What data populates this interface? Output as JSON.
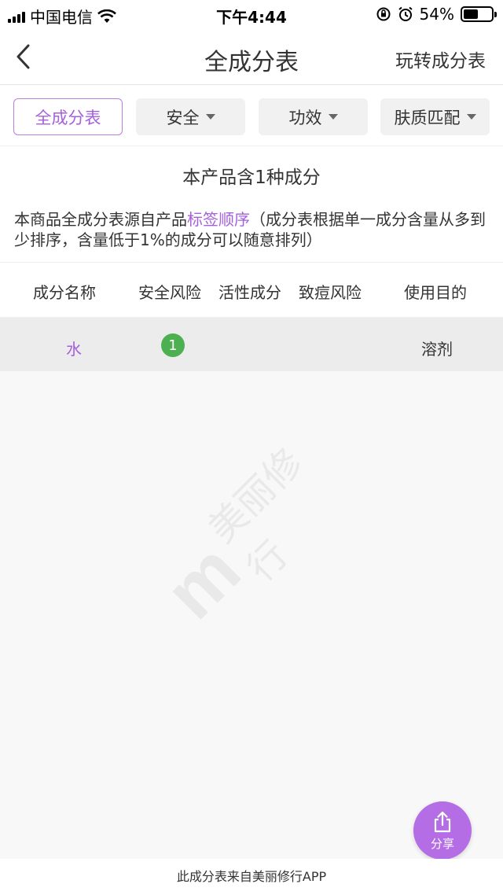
{
  "status_bar": {
    "carrier": "中国电信",
    "time": "下午4:44",
    "battery_percent": "54%",
    "battery_level": 0.54
  },
  "nav": {
    "title": "全成分表",
    "right_action": "玩转成分表"
  },
  "filters": [
    {
      "label": "全成分表",
      "active": true
    },
    {
      "label": "安全",
      "has_caret": true
    },
    {
      "label": "功效",
      "has_caret": true
    },
    {
      "label": "肤质匹配",
      "has_caret": true
    }
  ],
  "info": {
    "title": "本产品含1种成分",
    "desc_prefix": "本商品全成分表源自产品",
    "desc_link": "标签顺序",
    "desc_suffix": "（成分表根据单一成分含量从多到少排序，含量低于1%的成分可以随意排列）"
  },
  "table": {
    "headers": [
      "成分名称",
      "安全风险",
      "活性成分",
      "致痘风险",
      "使用目的"
    ],
    "rows": [
      {
        "name": "水",
        "safety": "1",
        "active": "",
        "acne": "",
        "purpose": "溶剂"
      }
    ]
  },
  "watermark": {
    "logo": "m",
    "text": "美丽修行"
  },
  "share": {
    "label": "分享"
  },
  "footer": {
    "text": "此成分表来自美丽修行APP"
  },
  "colors": {
    "accent": "#a560dd",
    "safe_green": "#4caf50"
  }
}
